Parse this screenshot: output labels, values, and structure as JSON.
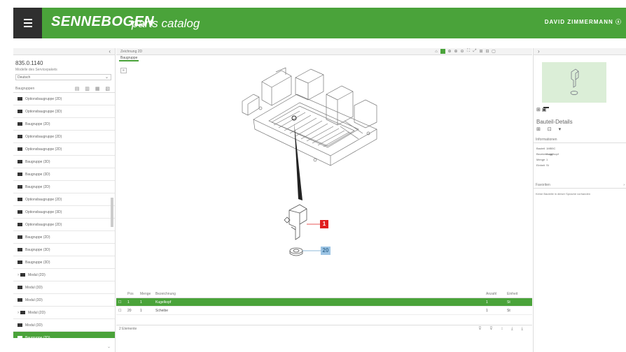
{
  "header": {
    "logo": "SENNEBOGEN",
    "logo_sub": "parts catalog",
    "user": "DAVID ZIMMERMANN"
  },
  "left_panel": {
    "collapse": "‹",
    "machine_id": "835.0.1140",
    "machine_sub": "Modelle des Servicepakets",
    "select_value": "Deutsch",
    "tree_header": "Baugruppen",
    "tree_tools": "▤ ▥ ▦ ▧",
    "tree_items": [
      {
        "label": "Optionsbaugruppe (2D)",
        "active": false,
        "expander": ""
      },
      {
        "label": "Optionsbaugruppe (3D)",
        "active": false,
        "expander": ""
      },
      {
        "label": "Baugruppe (2D)",
        "active": false,
        "expander": ""
      },
      {
        "label": "Optionsbaugruppe (2D)",
        "active": false,
        "expander": ""
      },
      {
        "label": "Optionsbaugruppe (2D)",
        "active": false,
        "expander": ""
      },
      {
        "label": "Baugruppe (3D)",
        "active": false,
        "expander": ""
      },
      {
        "label": "Baugruppe (3D)",
        "active": false,
        "expander": ""
      },
      {
        "label": "Baugruppe (2D)",
        "active": false,
        "expander": ""
      },
      {
        "label": "Optionsbaugruppe (2D)",
        "active": false,
        "expander": ""
      },
      {
        "label": "Optionsbaugruppe (3D)",
        "active": false,
        "expander": ""
      },
      {
        "label": "Optionsbaugruppe (2D)",
        "active": false,
        "expander": ""
      },
      {
        "label": "Baugruppe (2D)",
        "active": false,
        "expander": ""
      },
      {
        "label": "Baugruppe (3D)",
        "active": false,
        "expander": ""
      },
      {
        "label": "Baugruppe (3D)",
        "active": false,
        "expander": ""
      },
      {
        "label": "Modul (2D)",
        "active": false,
        "expander": "›"
      },
      {
        "label": "Modul (3D)",
        "active": false,
        "expander": ""
      },
      {
        "label": "Modul (3D)",
        "active": false,
        "expander": ""
      },
      {
        "label": "Modul (2D)",
        "active": false,
        "expander": "›"
      },
      {
        "label": "Modul (3D)",
        "active": false,
        "expander": ""
      },
      {
        "label": "Baugruppe (2D)",
        "active": true,
        "expander": ""
      }
    ],
    "scroll_down": "⌄"
  },
  "center": {
    "title": "Zeichnung 2D",
    "tab": "Baugruppe",
    "small_label": "≡",
    "toolbar_icons": [
      "⌂",
      "",
      "⊕",
      "⊕",
      "⊖",
      "⛶",
      "⤢",
      "⊞",
      "⊟",
      "▢"
    ],
    "callouts": [
      {
        "label": "1",
        "color": "#e02020"
      },
      {
        "label": "20",
        "color": "#9cc4e4"
      }
    ],
    "table": {
      "headers": [
        "",
        "Pos",
        "Menge",
        "Bezeichnung",
        "Anzahl",
        "Einheit"
      ],
      "rows": [
        {
          "pos": "1",
          "qty": "1",
          "name": "Kugelkopf",
          "count": "1",
          "unit": "St",
          "selected": true
        },
        {
          "pos": "20",
          "qty": "1",
          "name": "Scheibe",
          "count": "1",
          "unit": "St",
          "selected": false
        }
      ]
    },
    "footer": "2 Elemente",
    "footer_icons": "⊽ ⊽ ↕ ⤓ ⤓"
  },
  "right_panel": {
    "collapse": "›",
    "tabs": "⊞ ▣",
    "bom_title": "Bauteil-Details",
    "bom_icons": "⊞ ⊡ ▾",
    "info_header": "Informationen",
    "info_rows": [
      {
        "k": "Bauteil",
        "v": "1MB5C"
      },
      {
        "k": "Bezeichnung",
        "v": "Kugelkopf"
      },
      {
        "k": "Menge",
        "v": "1"
      },
      {
        "k": "Einheit",
        "v": "St"
      }
    ],
    "fav_header": "Favoriten",
    "fav_x": "›",
    "fav_text": "Keine Bauteile in dieser Sprache vorhanden"
  },
  "colors": {
    "brand_green": "#4aa33a",
    "header_dark": "#2f2f2f",
    "callout_red": "#e02020",
    "callout_blue": "#9cc4e4"
  }
}
